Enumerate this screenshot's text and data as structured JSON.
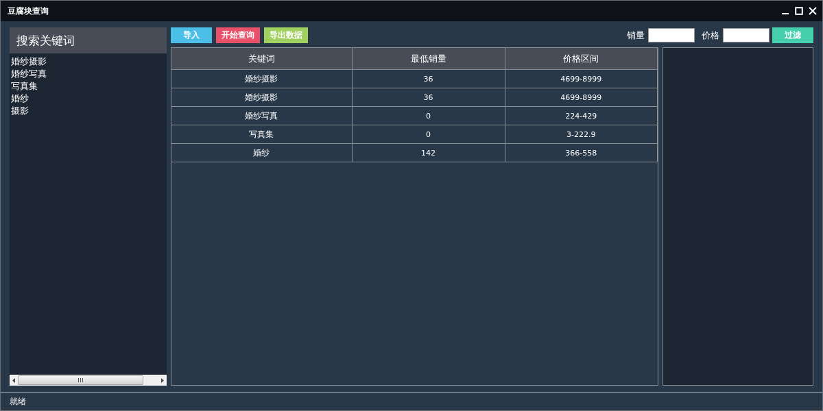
{
  "window": {
    "title": "豆腐块查询"
  },
  "sidebar": {
    "title": "搜索关键词",
    "items": [
      "婚纱摄影",
      "婚纱写真",
      "写真集",
      "婚纱",
      "摄影"
    ]
  },
  "toolbar": {
    "buttons": [
      {
        "label": "导入",
        "color": "#4cbfe9"
      },
      {
        "label": "开始查询",
        "color": "#e9506a"
      },
      {
        "label": "导出数据",
        "color": "#a0d15f"
      }
    ],
    "filters": [
      {
        "label": "销量"
      },
      {
        "label": "价格"
      }
    ],
    "filter_button": {
      "label": "过滤",
      "color": "#45cfad"
    }
  },
  "table": {
    "columns": [
      "关键词",
      "最低销量",
      "价格区间"
    ],
    "rows": [
      [
        "婚纱摄影",
        "36",
        "4699-8999"
      ],
      [
        "婚纱摄影",
        "36",
        "4699-8999"
      ],
      [
        "婚纱写真",
        "0",
        "224-429"
      ],
      [
        "写真集",
        "0",
        "3-222.9"
      ],
      [
        "婚纱",
        "142",
        "366-558"
      ]
    ]
  },
  "status_bar": {
    "text": "就绪"
  }
}
